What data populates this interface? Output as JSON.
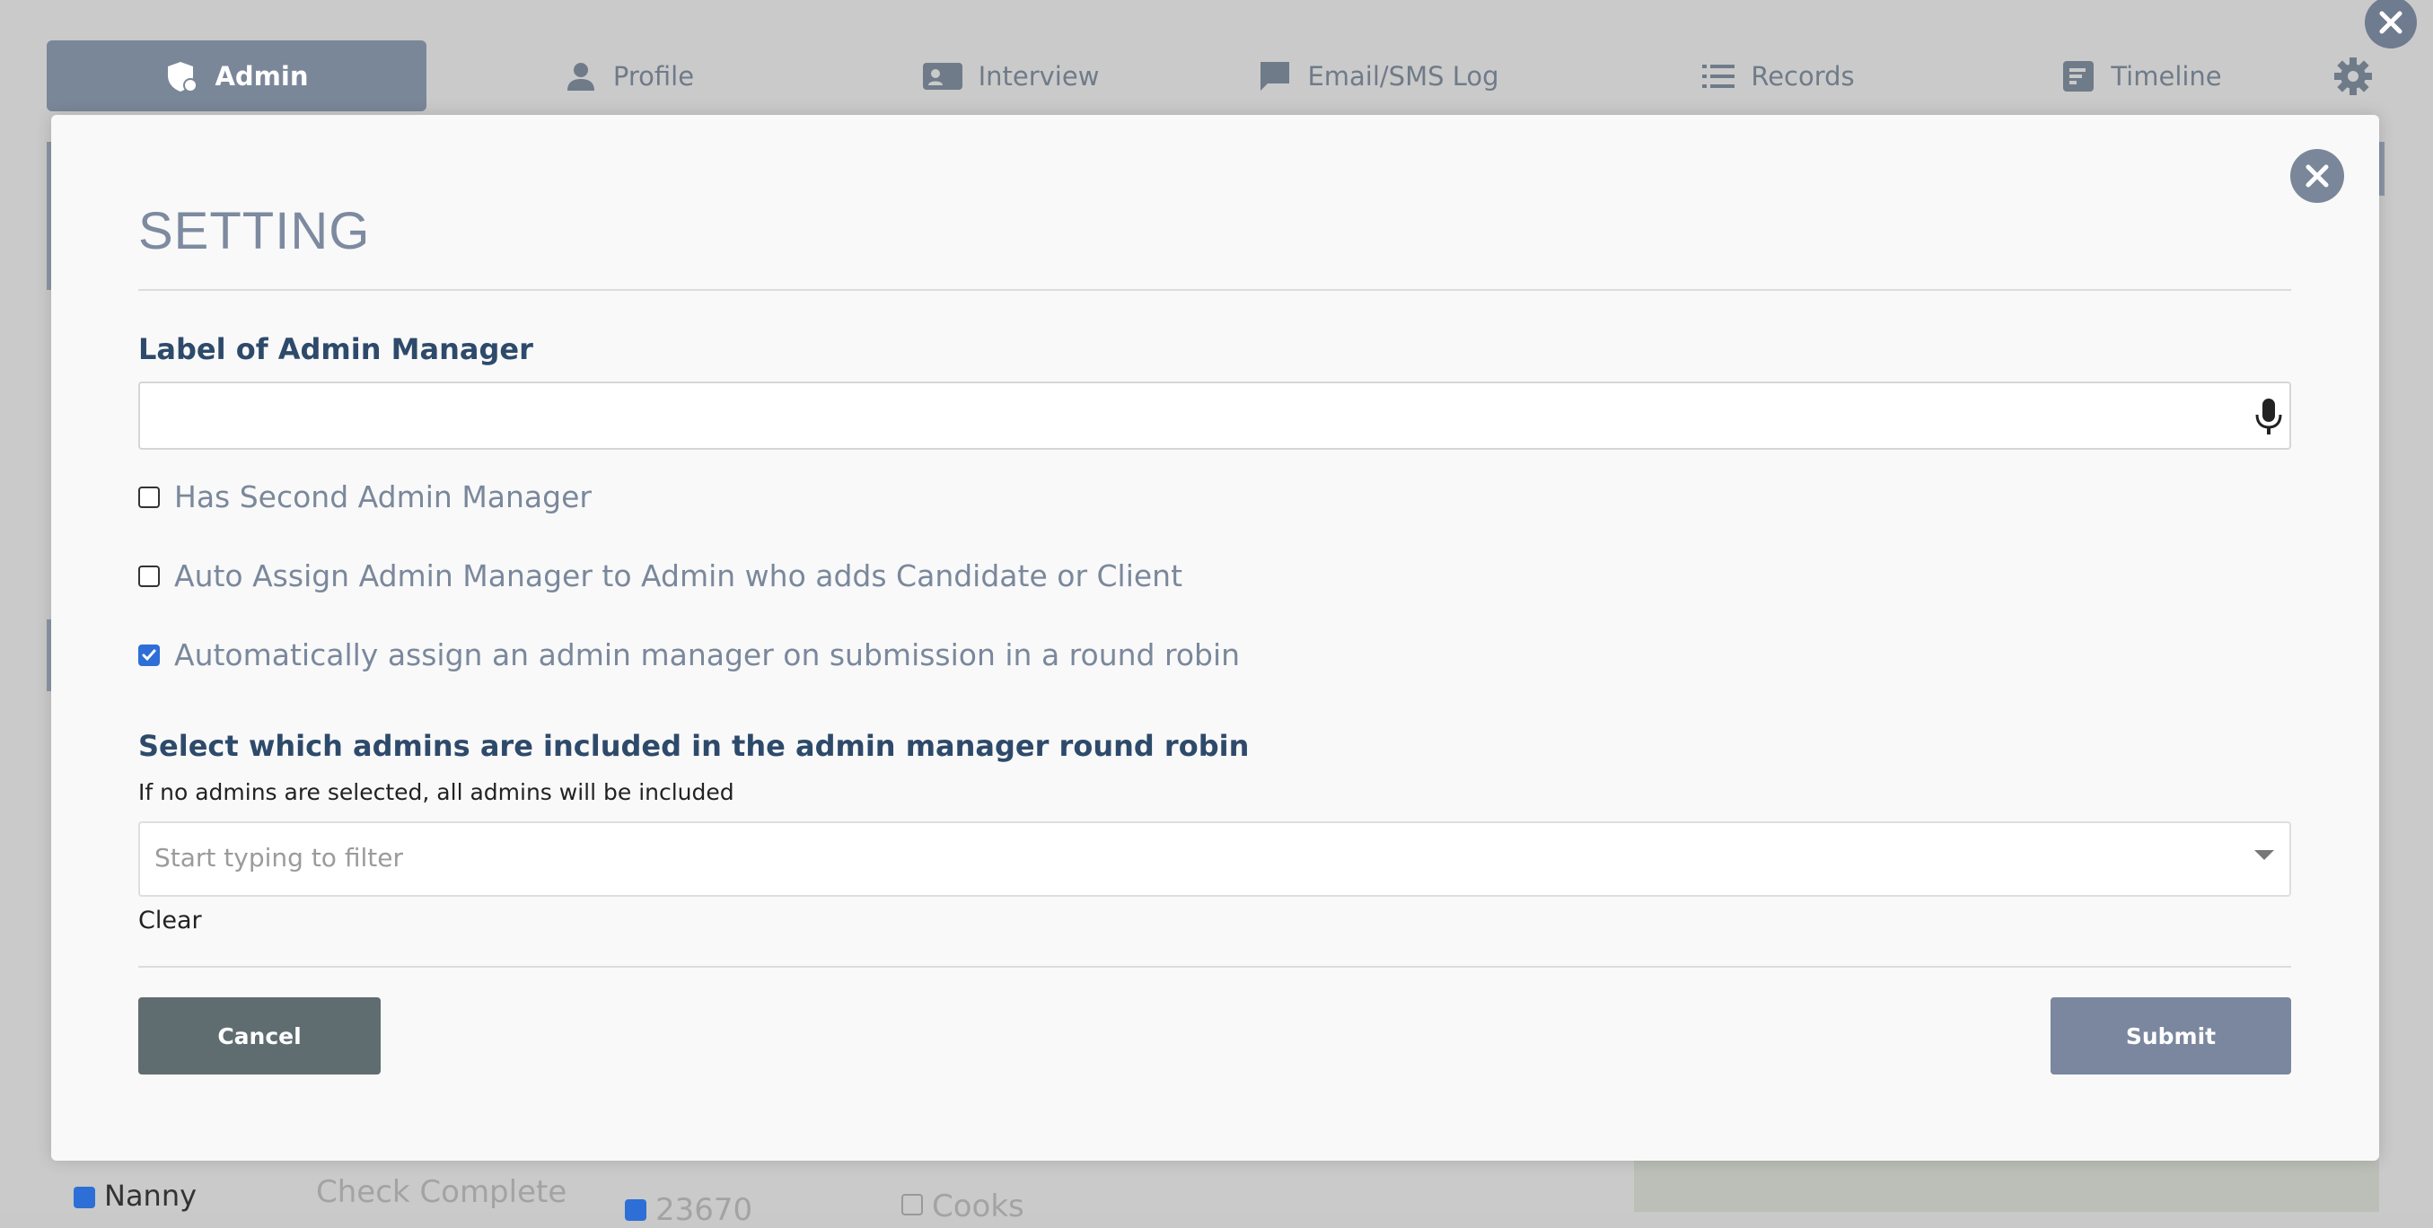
{
  "nav": {
    "tabs": [
      {
        "label": "Admin",
        "icon": "admin-shield-icon"
      },
      {
        "label": "Profile",
        "icon": "person-icon"
      },
      {
        "label": "Interview",
        "icon": "interview-card-icon"
      },
      {
        "label": "Email/SMS Log",
        "icon": "chat-bubble-icon"
      },
      {
        "label": "Records",
        "icon": "list-icon"
      },
      {
        "label": "Timeline",
        "icon": "timeline-icon"
      }
    ],
    "active_tab": "Admin"
  },
  "background": {
    "nanny_label": "Nanny",
    "check_complete_label": "Check Complete",
    "region_value": "23670",
    "cooks_label": "Cooks"
  },
  "modal": {
    "title": "SETTING",
    "label_admin_manager": "Label of Admin Manager",
    "label_input_value": "",
    "checkboxes": [
      {
        "label": "Has Second Admin Manager",
        "checked": false
      },
      {
        "label": "Auto Assign Admin Manager to Admin who adds Candidate or Client",
        "checked": false
      },
      {
        "label": "Automatically assign an admin manager on submission in a round robin",
        "checked": true
      }
    ],
    "round_robin_heading": "Select which admins are included in the admin manager round robin",
    "round_robin_hint": "If no admins are selected, all admins will be included",
    "filter_placeholder": "Start typing to filter",
    "clear_label": "Clear",
    "cancel_label": "Cancel",
    "submit_label": "Submit"
  },
  "colors": {
    "accent": "#7a879e",
    "heading": "#2e4a6b",
    "checkbox_checked": "#2d6fd6",
    "cancel_button": "#606d70"
  }
}
